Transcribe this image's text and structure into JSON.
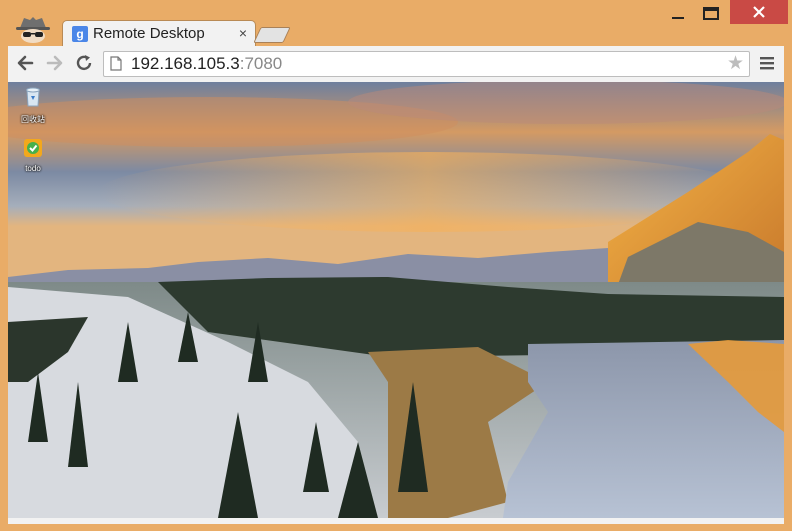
{
  "window": {
    "tab_title": "Remote Desktop",
    "favicon_letter": "g",
    "close_glyph": "×",
    "controls": [
      "minimize",
      "maximize",
      "close"
    ]
  },
  "toolbar": {
    "url_host": "192.168.105.3",
    "url_port": ":7080",
    "star_glyph": "★"
  },
  "desktop": {
    "icons": [
      {
        "label": "回收站",
        "icon": "recycle-bin-icon"
      },
      {
        "label": "todo",
        "icon": "todo-app-icon"
      }
    ]
  },
  "colors": {
    "frame": "#e9ac67",
    "close_button": "#c94a45",
    "toolbar": "#f2f2f2",
    "favicon": "#4a86e8"
  }
}
